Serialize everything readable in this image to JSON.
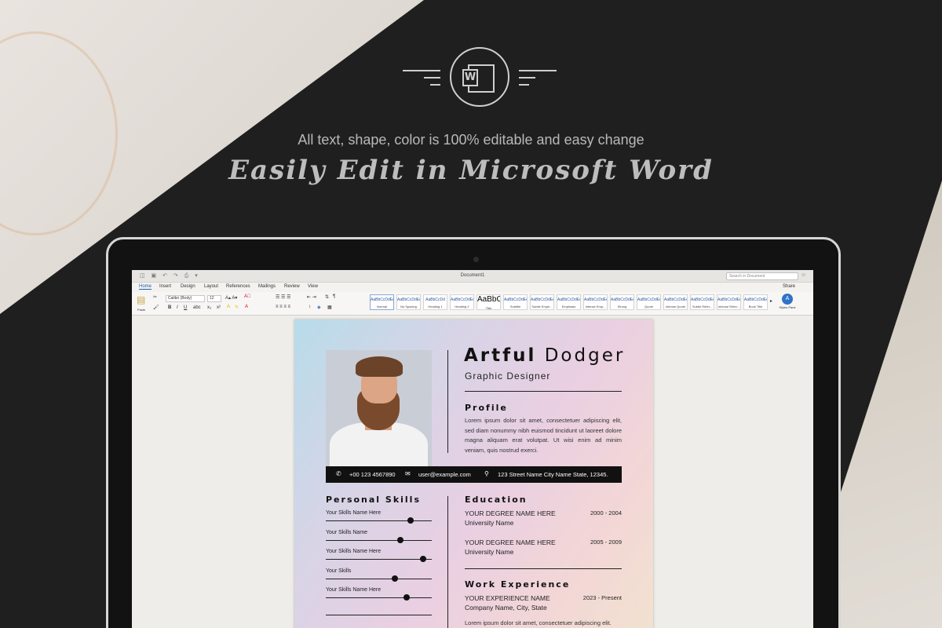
{
  "header": {
    "tagline": "All text, shape, color is 100% editable and easy change",
    "headline": "Easily Edit in Microsoft Word",
    "logo_letter": "W"
  },
  "word": {
    "document_title": "Document1",
    "search_placeholder": "Search in Document",
    "tabs": [
      "Home",
      "Insert",
      "Design",
      "Layout",
      "References",
      "Mailings",
      "Review",
      "View"
    ],
    "active_tab": "Home",
    "share_label": "Share",
    "ribbon": {
      "paste_label": "Paste",
      "font_name": "Calibri (Body)",
      "font_size": "12",
      "styles_pane_label": "Styles Pane",
      "styles": [
        {
          "sample": "AaBbCcDdEe",
          "name": "Normal"
        },
        {
          "sample": "AaBbCcDdEe",
          "name": "No Spacing"
        },
        {
          "sample": "AaBbCcDd",
          "name": "Heading 1"
        },
        {
          "sample": "AaBbCcDdEe",
          "name": "Heading 2"
        },
        {
          "sample": "AaBbC",
          "name": "Title"
        },
        {
          "sample": "AaBbCcDdEe",
          "name": "Subtitle"
        },
        {
          "sample": "AaBbCcDdEe",
          "name": "Subtle Emph..."
        },
        {
          "sample": "AaBbCcDdEe",
          "name": "Emphasis"
        },
        {
          "sample": "AaBbCcDdEe",
          "name": "Intense Emp..."
        },
        {
          "sample": "AaBbCcDdEe",
          "name": "Strong"
        },
        {
          "sample": "AaBbCcDdEe",
          "name": "Quote"
        },
        {
          "sample": "AaBbCcDdEe",
          "name": "Intense Quote"
        },
        {
          "sample": "AaBbCcDdEe",
          "name": "Subtle Refer..."
        },
        {
          "sample": "AaBbCcDdEe",
          "name": "Intense Refer..."
        },
        {
          "sample": "AaBbCcDdEe",
          "name": "Book Title"
        }
      ]
    }
  },
  "resume": {
    "first_name": "Artful",
    "last_name": "Dodger",
    "job_title": "Graphic Designer",
    "profile_title": "Profile",
    "profile_text": "Lorem ipsum dolor sit amet, consectetuer adipiscing elit, sed diam nonummy nibh euismod tincidunt ut laoreet dolore magna aliquam erat volutpat. Ut wisi enim ad minim veniam, quis nostrud exerci.",
    "contact": {
      "phone": "+00 123 4567890",
      "email": "user@example.com",
      "address": "123 Street Name City Name State, 12345."
    },
    "skills_title": "Personal Skills",
    "skills": [
      {
        "label": "Your Skills Name Here",
        "level": 0.8
      },
      {
        "label": "Your Skills Name",
        "level": 0.7
      },
      {
        "label": "Your Skills Name Here",
        "level": 0.92
      },
      {
        "label": "Your Skills",
        "level": 0.65
      },
      {
        "label": "Your Skills Name Here",
        "level": 0.76
      }
    ],
    "education_title": "Education",
    "education": [
      {
        "degree": "YOUR DEGREE NAME HERE",
        "university": "University Name",
        "years": "2000 - 2004"
      },
      {
        "degree": "YOUR DEGREE NAME HERE",
        "university": "University Name",
        "years": "2005 - 2009"
      }
    ],
    "experience_title": "Work Experience",
    "experience": [
      {
        "position": "YOUR EXPERIENCE NAME",
        "company": "Company Name, City, State",
        "years": "2023 - Present"
      }
    ],
    "experience_text": "Lorem ipsum dolor sit amet, consectetuer adipiscing elit."
  },
  "icons": [
    "word-logo-icon",
    "phone-icon",
    "email-icon",
    "location-pin-icon"
  ],
  "colors": {
    "background": "#1f1f1f",
    "accent_blue": "#1b5fb3",
    "resume_dark": "#111111"
  }
}
